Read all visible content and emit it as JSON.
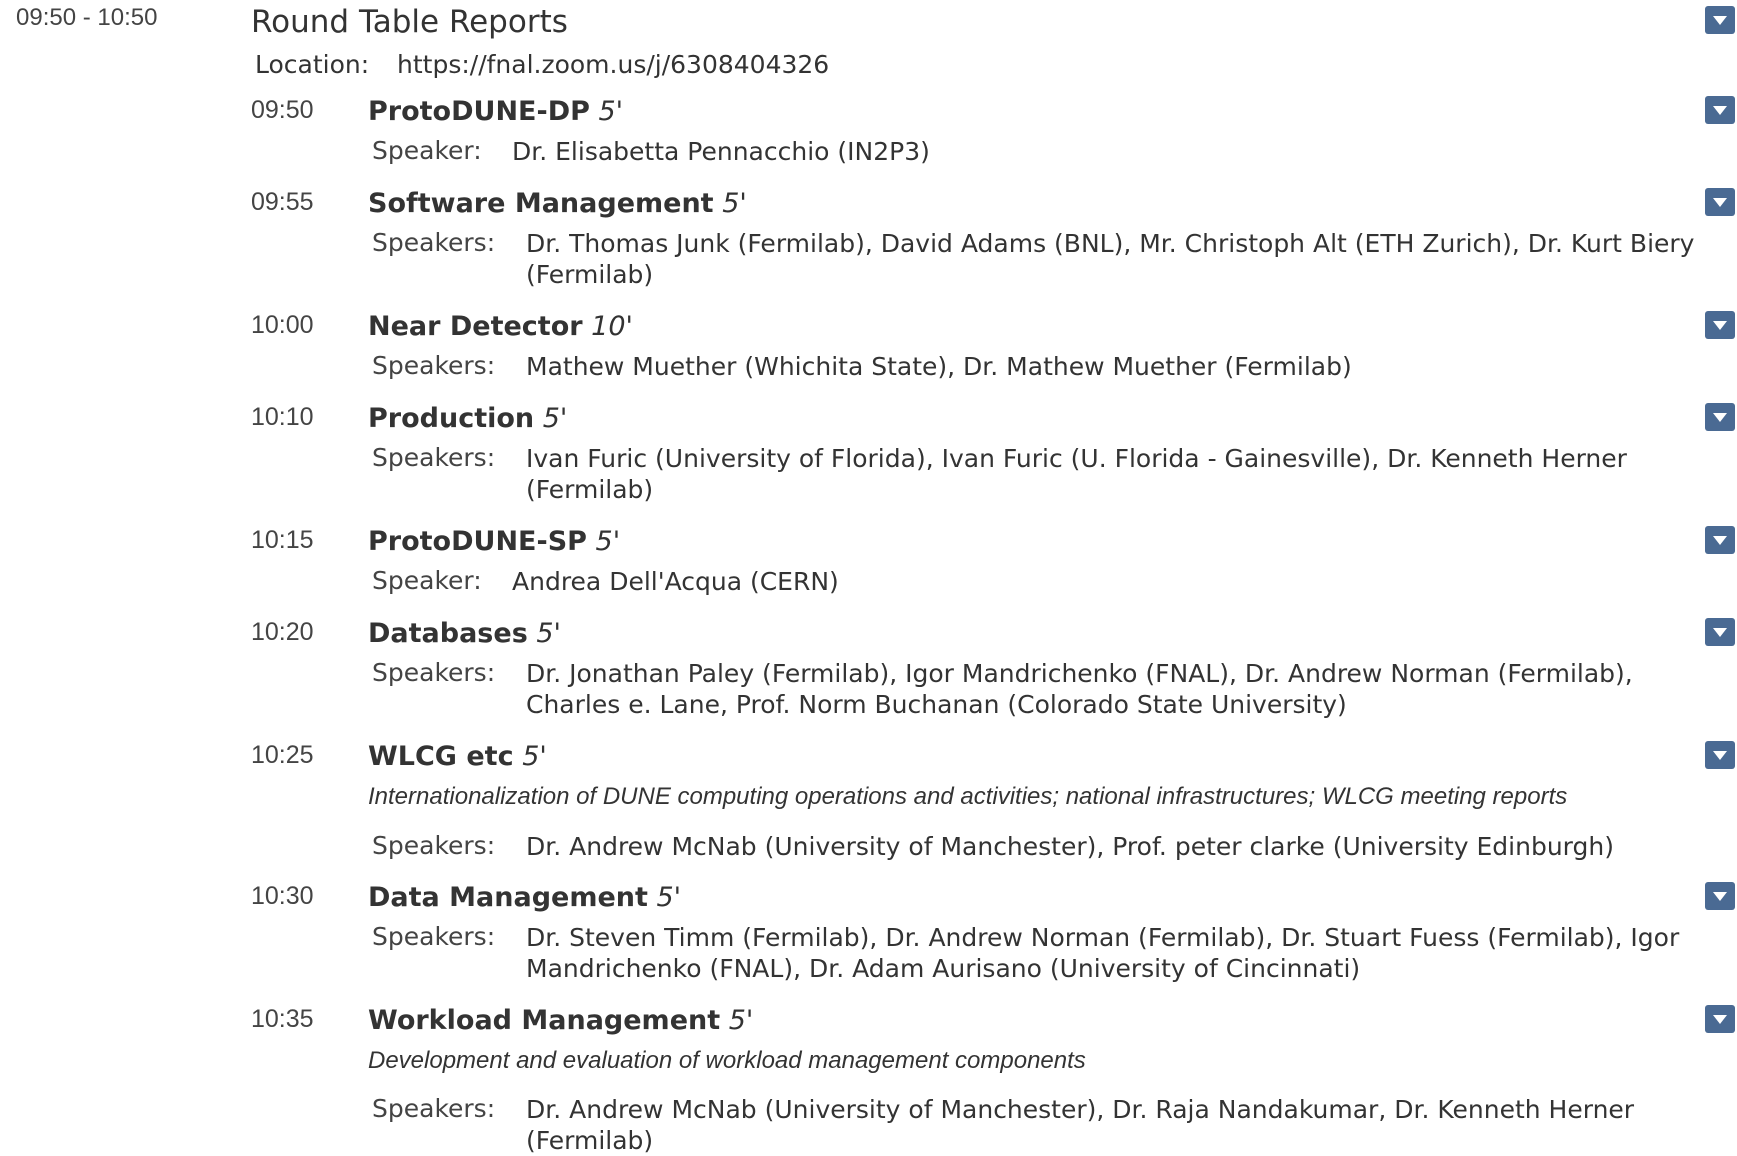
{
  "session": {
    "time_range": "09:50 - 10:50",
    "title": "Round Table Reports",
    "location_label": "Location:",
    "location_value": "https://fnal.zoom.us/j/6308404326"
  },
  "contributions": [
    {
      "time": "09:50",
      "title": "ProtoDUNE-DP",
      "duration": "5'",
      "speaker_label": "Speaker:",
      "speakers": "Dr. Elisabetta Pennacchio (IN2P3)"
    },
    {
      "time": "09:55",
      "title": "Software Management",
      "duration": "5'",
      "speaker_label": "Speakers:",
      "speakers": "Dr. Thomas Junk (Fermilab), David Adams (BNL), Mr. Christoph Alt (ETH Zurich), Dr. Kurt Biery (Fermilab)"
    },
    {
      "time": "10:00",
      "title": "Near Detector",
      "duration": "10'",
      "speaker_label": "Speakers:",
      "speakers": "Mathew Muether (Whichita State), Dr. Mathew Muether (Fermilab)"
    },
    {
      "time": "10:10",
      "title": "Production",
      "duration": "5'",
      "speaker_label": "Speakers:",
      "speakers": "Ivan Furic (University of Florida), Ivan Furic (U. Florida - Gainesville), Dr. Kenneth Herner (Fermilab)"
    },
    {
      "time": "10:15",
      "title": "ProtoDUNE-SP",
      "duration": "5'",
      "speaker_label": "Speaker:",
      "speakers": "Andrea Dell'Acqua (CERN)"
    },
    {
      "time": "10:20",
      "title": "Databases",
      "duration": "5'",
      "speaker_label": "Speakers:",
      "speakers": "Dr. Jonathan Paley (Fermilab), Igor Mandrichenko (FNAL), Dr. Andrew Norman (Fermilab), Charles e. Lane, Prof. Norm Buchanan (Colorado State University)"
    },
    {
      "time": "10:25",
      "title": "WLCG etc",
      "duration": "5'",
      "description": "Internationalization of DUNE computing operations and activities; national infrastructures; WLCG meeting reports",
      "speaker_label": "Speakers:",
      "speakers": "Dr. Andrew McNab (University of Manchester), Prof. peter clarke (University Edinburgh)"
    },
    {
      "time": "10:30",
      "title": "Data Management",
      "duration": "5'",
      "speaker_label": "Speakers:",
      "speakers": "Dr. Steven Timm (Fermilab), Dr. Andrew Norman (Fermilab), Dr. Stuart Fuess (Fermilab), Igor Mandrichenko (FNAL), Dr. Adam Aurisano (University of Cincinnati)"
    },
    {
      "time": "10:35",
      "title": "Workload Management",
      "duration": "5'",
      "description": "Development and evaluation of workload management components",
      "speaker_label": "Speakers:",
      "speakers": "Dr. Andrew McNab (University of Manchester), Dr. Raja Nandakumar, Dr. Kenneth Herner (Fermilab)"
    }
  ],
  "icons": {
    "menu_button": "chevron-down-icon",
    "accent": "#4a6a93"
  }
}
